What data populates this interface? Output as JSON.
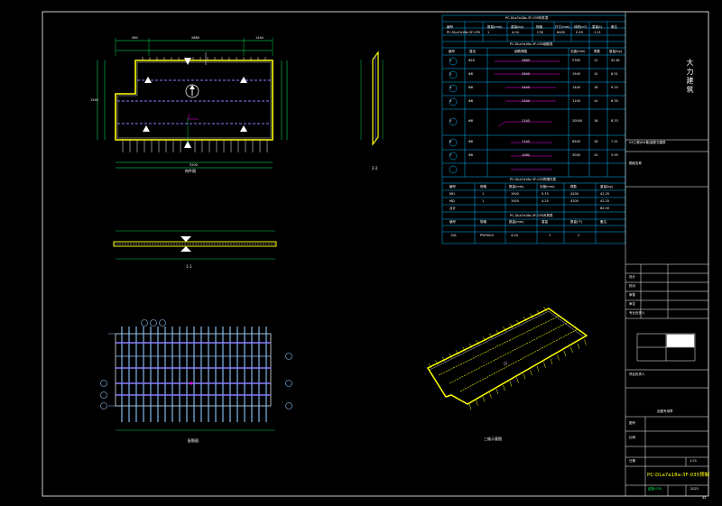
{
  "colors": {
    "background": "#000000",
    "frame": "#ffffff",
    "slab_fill": "#ffff00",
    "outline": "#ffffff",
    "rebar": "#8a7cff",
    "rebar_light": "#8ec8ff",
    "table_line": "#00b7ff",
    "dim": "#00ff60",
    "magenta": "#ff00ff",
    "text_yellow": "#ffff00"
  },
  "views": {
    "plan_title": "构件图",
    "section_11_label": "1-1",
    "section_22_label": "2-2",
    "rebar_title": "配筋图",
    "iso_title": "三维示意图"
  },
  "plan": {
    "dim_top": [
      "560",
      "2880",
      "1440"
    ],
    "dim_bottom": "3200",
    "dim_left": "1540",
    "section_labels": [
      "1",
      "1",
      "2",
      "2"
    ]
  },
  "tables": {
    "t1_title": "PC-DLa7a18a-3F-035构件表",
    "t1_headers": [
      "编号",
      "数量(mm)",
      "重量(kg)",
      "规格",
      "尺寸(mm)",
      "体积(m³)",
      "重量(t)",
      "备注"
    ],
    "t1_row": [
      "PC-DLa7a18a-3F-035",
      "1",
      "4.04",
      "C30",
      "6400",
      "0.49",
      "1.21",
      ""
    ],
    "t2_title": "PC-DLa7a18a-3F-035钢筋表",
    "t2_headers": [
      "编号",
      "直径",
      "钢筋简图",
      "长度(mm)",
      "根数",
      "重量(kg)"
    ],
    "t2_rows": [
      [
        "1",
        "Φ10",
        "2880",
        "5760",
        "12",
        "42.61"
      ],
      [
        "2",
        "Φ8",
        "1540",
        "1540",
        "14",
        "8.51"
      ],
      [
        "3",
        "Φ8",
        "1440",
        "1440",
        "16",
        "9.10"
      ],
      [
        "4",
        "Φ8",
        "1140",
        "1140",
        "14",
        "6.30"
      ],
      [
        "5",
        "Φ8",
        "1140",
        "20040",
        "16",
        "8.33"
      ],
      [
        "6",
        "Φ8",
        "1140",
        "6540",
        "18",
        "7.41"
      ],
      [
        "7",
        "Φ8",
        "1080",
        "3040",
        "14",
        "5.95"
      ]
    ],
    "t3_title": "PC-DLa7a18a-3F-035预埋件表",
    "t3_headers": [
      "编号",
      "规格",
      "数量(mm)",
      "长度(mm)",
      "根数",
      "重量(kg)"
    ],
    "t3_rows": [
      [
        "MJ1",
        "1",
        "1920",
        "5.15",
        "4200",
        "42.25"
      ],
      [
        "MJ2",
        "1",
        "1920",
        "4.25",
        "4200",
        "42.25"
      ],
      [
        "合计",
        "",
        "",
        "",
        "",
        "84.50"
      ]
    ],
    "t4_title": "PC-DLa7a18a-3F-035吊具表",
    "t4_headers": [
      "编号",
      "规格",
      "数量(mm)",
      "重量",
      "数量(个)",
      "备注"
    ],
    "t4_row": [
      "DJ1",
      "PW50U4",
      "4.04",
      "1",
      "2",
      ""
    ]
  },
  "titleblock": {
    "logo_chars": "大力建筑",
    "project_line": "XX工程(6#楼)装配式建筑",
    "drawing_name_label": "图纸名称",
    "design_label": "设计",
    "check_label": "校对",
    "review_label": "审核",
    "approve_label": "审定",
    "leader_label": "专业负责人",
    "proj_leader_label": "项目负责人",
    "seal_label": "出图专用章",
    "drawing_no_label": "图号",
    "scale_label": "比例",
    "date_label": "日期",
    "drawing_title": "PC-DLa7a18a-3F-035预制",
    "scale_value": "1:25",
    "date_value": "2023",
    "drawing_no_value": "结施-035",
    "page_no": "42"
  }
}
